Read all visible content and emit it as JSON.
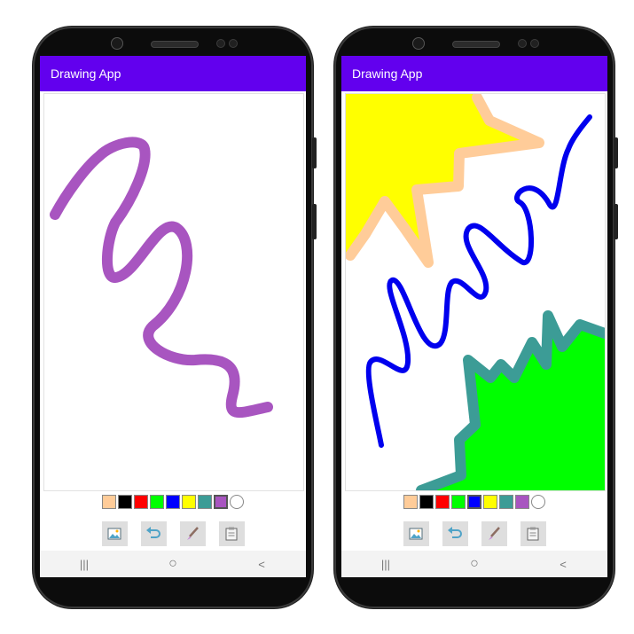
{
  "screens": [
    {
      "app_title": "Drawing App",
      "palette": [
        {
          "name": "peach",
          "hex": "#ffcc99"
        },
        {
          "name": "black",
          "hex": "#000000"
        },
        {
          "name": "red",
          "hex": "#ff0000"
        },
        {
          "name": "green",
          "hex": "#00ff00"
        },
        {
          "name": "blue",
          "hex": "#0000ff"
        },
        {
          "name": "yellow",
          "hex": "#ffff00"
        },
        {
          "name": "teal",
          "hex": "#3c9c96"
        },
        {
          "name": "purple",
          "hex": "#a855c0",
          "selected": true
        },
        {
          "name": "white",
          "hex": "#ffffff"
        }
      ],
      "tools": [
        {
          "name": "image-icon",
          "label": "pick background image"
        },
        {
          "name": "undo-icon",
          "label": "undo"
        },
        {
          "name": "brush-icon",
          "label": "brush size"
        },
        {
          "name": "save-icon",
          "label": "save"
        }
      ],
      "strokes": [
        {
          "color": "#a855c0",
          "description": "purple zigzag stroke"
        }
      ]
    },
    {
      "app_title": "Drawing App",
      "palette": [
        {
          "name": "peach",
          "hex": "#ffcc99"
        },
        {
          "name": "black",
          "hex": "#000000"
        },
        {
          "name": "red",
          "hex": "#ff0000"
        },
        {
          "name": "green",
          "hex": "#00ff00"
        },
        {
          "name": "blue",
          "hex": "#0000ff",
          "selected": true
        },
        {
          "name": "yellow",
          "hex": "#ffff00"
        },
        {
          "name": "teal",
          "hex": "#3c9c96"
        },
        {
          "name": "purple",
          "hex": "#a855c0"
        },
        {
          "name": "white",
          "hex": "#ffffff"
        }
      ],
      "tools": [
        {
          "name": "image-icon",
          "label": "pick background image"
        },
        {
          "name": "undo-icon",
          "label": "undo"
        },
        {
          "name": "brush-icon",
          "label": "brush size"
        },
        {
          "name": "save-icon",
          "label": "save"
        }
      ],
      "strokes": [
        {
          "color": "#ffff00",
          "description": "yellow filled shape top-left"
        },
        {
          "color": "#ffcc99",
          "description": "peach outline around yellow shape"
        },
        {
          "color": "#0000ff",
          "description": "blue zigzag stroke"
        },
        {
          "color": "#00ff00",
          "description": "green filled shape bottom-right"
        },
        {
          "color": "#3c9c96",
          "description": "teal outline around green shape"
        }
      ]
    }
  ],
  "nav": {
    "recents": "|||",
    "home": "○",
    "back": "<"
  }
}
